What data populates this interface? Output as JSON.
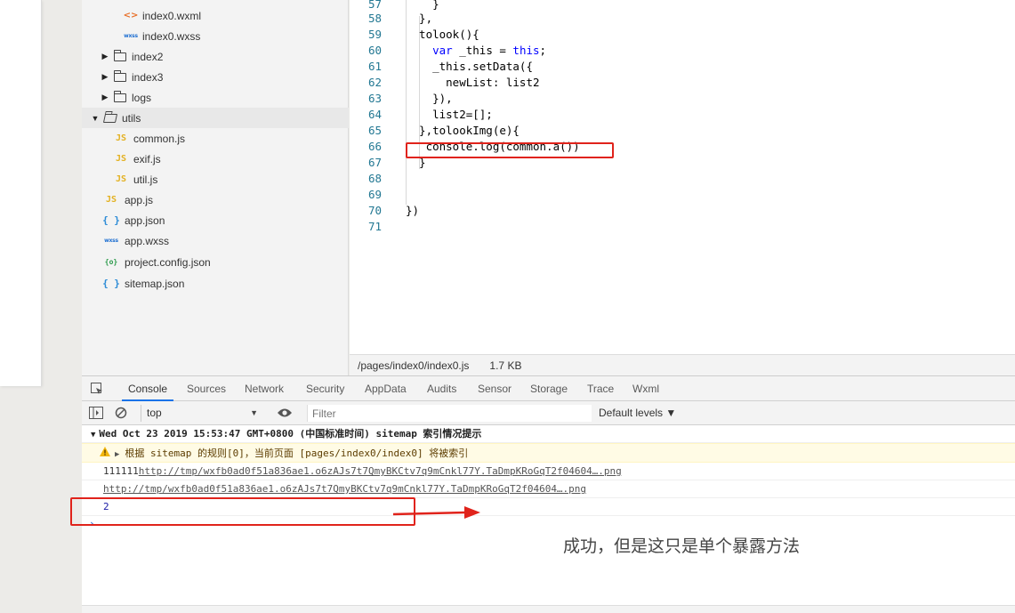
{
  "tree": {
    "items": [
      {
        "label": "index0.wxml",
        "icon": "xml-icon"
      },
      {
        "label": "index0.wxss",
        "icon": "wxss-icon"
      },
      {
        "label": "index2",
        "icon": "folder-icon"
      },
      {
        "label": "index3",
        "icon": "folder-icon"
      },
      {
        "label": "logs",
        "icon": "folder-icon"
      },
      {
        "label": "utils",
        "icon": "folder-open-icon"
      },
      {
        "label": "common.js",
        "icon": "js-icon"
      },
      {
        "label": "exif.js",
        "icon": "js-icon"
      },
      {
        "label": "util.js",
        "icon": "js-icon"
      },
      {
        "label": "app.js",
        "icon": "js-icon"
      },
      {
        "label": "app.json",
        "icon": "json-icon"
      },
      {
        "label": "app.wxss",
        "icon": "wxss-icon"
      },
      {
        "label": "project.config.json",
        "icon": "config-icon"
      },
      {
        "label": "sitemap.json",
        "icon": "json-icon"
      }
    ],
    "icon_glyphs": {
      "xml": "<>",
      "wxss": "wxss",
      "js": "JS",
      "json": "{ }",
      "config": "{o}"
    }
  },
  "editor": {
    "lines": [
      {
        "n": "57",
        "code": "    }"
      },
      {
        "n": "58",
        "code": "  },"
      },
      {
        "n": "59",
        "code": "  tolook(){"
      },
      {
        "n": "60",
        "pre": "    ",
        "kw": "var",
        "code": " _this = ",
        "kw2": "this",
        "post": ";"
      },
      {
        "n": "61",
        "code": "    _this.setData({"
      },
      {
        "n": "62",
        "code": "      newList: list2"
      },
      {
        "n": "63",
        "code": "    }),"
      },
      {
        "n": "64",
        "code": "    list2=[];"
      },
      {
        "n": "65",
        "code": "  },tolookImg(e){"
      },
      {
        "n": "66",
        "code": "   console.log(common.a())"
      },
      {
        "n": "67",
        "code": "  }"
      },
      {
        "n": "68",
        "code": ""
      },
      {
        "n": "69",
        "code": ""
      },
      {
        "n": "70",
        "code": "})"
      },
      {
        "n": "71",
        "code": ""
      }
    ],
    "status_path": "/pages/index0/index0.js",
    "status_size": "1.7 KB"
  },
  "devtools": {
    "tabs": [
      "Console",
      "Sources",
      "Network",
      "Security",
      "AppData",
      "Audits",
      "Sensor",
      "Storage",
      "Trace",
      "Wxml"
    ],
    "active_tab": "Console",
    "context": "top",
    "filter_placeholder": "Filter",
    "levels": "Default levels ▼",
    "group_header": "Wed Oct 23 2019 15:53:47 GMT+0800 (中国标准时间) sitemap 索引情况提示",
    "warning": "根据 sitemap 的规则[0]，当前页面 [pages/index0/index0] 将被索引",
    "log1_prefix": "111111",
    "log1_link": "http://tmp/wxfb0ad0f51a836ae1.o6zAJs7t7QmyBKCtv7q9mCnkl77Y.TaDmpKRoGqT2f04604….png",
    "log2_link": "http://tmp/wxfb0ad0f51a836ae1.o6zAJs7t7QmyBKCtv7q9mCnkl77Y.TaDmpKRoGqT2f04604….png",
    "result": "2",
    "prompt": "›"
  },
  "annotation": {
    "note": "成功，但是这只是单个暴露方法",
    "color": "#e0231b"
  }
}
